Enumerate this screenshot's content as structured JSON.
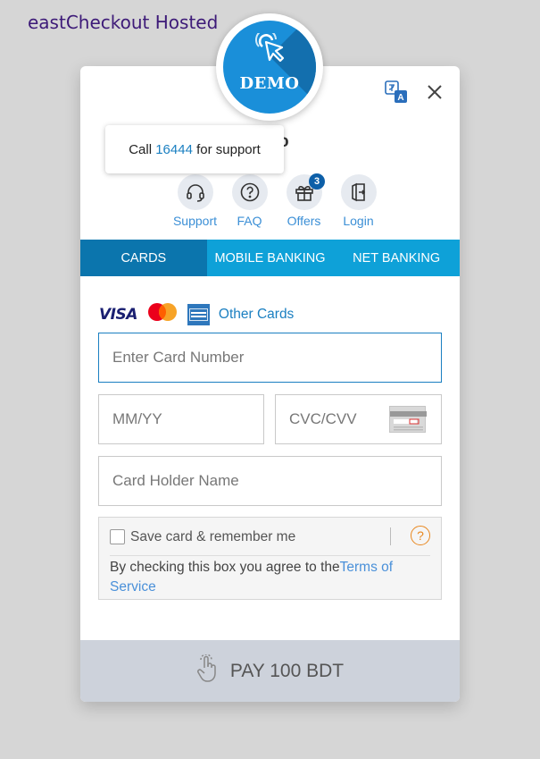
{
  "page_title": "eastCheckout Hosted",
  "demo_badge": "DEMO",
  "merchant_name_partial": "o",
  "support_tooltip": {
    "prefix": "Call ",
    "number": "16444",
    "suffix": " for support"
  },
  "quick_links": [
    {
      "label": "Support",
      "icon": "headset-icon"
    },
    {
      "label": "FAQ",
      "icon": "question-icon"
    },
    {
      "label": "Offers",
      "icon": "gift-icon",
      "badge": "3"
    },
    {
      "label": "Login",
      "icon": "login-icon"
    }
  ],
  "tabs": [
    {
      "label": "CARDS",
      "active": true
    },
    {
      "label": "MOBILE BANKING",
      "active": false
    },
    {
      "label": "NET BANKING",
      "active": false
    }
  ],
  "card_types": {
    "visa": "VISA",
    "other_cards": "Other Cards"
  },
  "form": {
    "card_number_placeholder": "Enter Card Number",
    "expiry_placeholder": "MM/YY",
    "cvc_placeholder": "CVC/CVV",
    "holder_placeholder": "Card Holder Name"
  },
  "save_card": {
    "label": "Save card & remember me",
    "terms_prefix": "By checking this box you agree to the ",
    "terms_link": "Terms of Service"
  },
  "pay_button": "PAY 100 BDT",
  "colors": {
    "primary_tab": "#0ea1d8",
    "active_tab": "#0b75ad",
    "link": "#1a7fc1",
    "title": "#3d1a78"
  }
}
